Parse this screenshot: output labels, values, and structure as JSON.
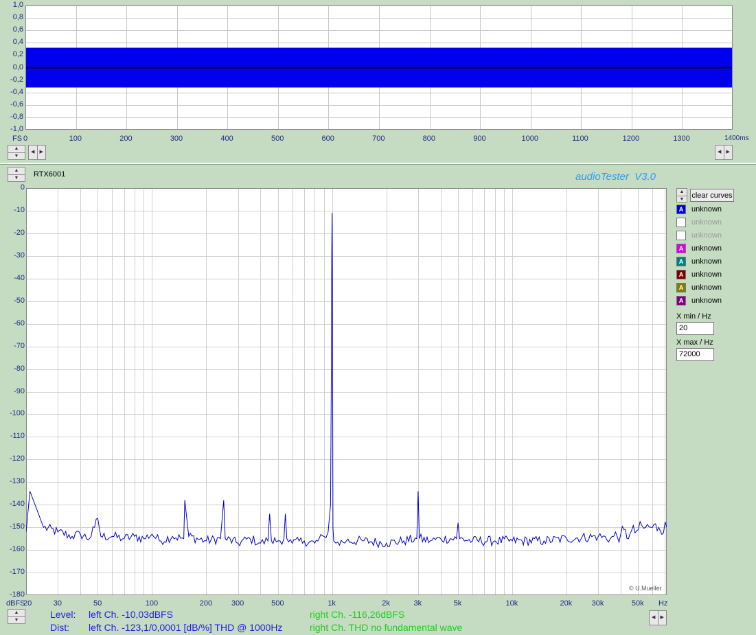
{
  "top_scope": {
    "y_ticks": [
      "1,0",
      "0,8",
      "0,6",
      "0,4",
      "0,2",
      "0,0",
      "-0,2",
      "-0,4",
      "-0,6",
      "-0,8",
      "-1,0"
    ],
    "x_ticks": [
      "0",
      "100",
      "200",
      "300",
      "400",
      "500",
      "600",
      "700",
      "800",
      "900",
      "1000",
      "1100",
      "1200",
      "1300",
      "1400ms"
    ],
    "y_unit": "FS",
    "band_level": 0.32,
    "x_max_ms": 1400
  },
  "spectrum": {
    "device": "RTX6001",
    "app_title": "audioTester  V3.0",
    "copyright": "© U.Mueller",
    "y_unit": "dBFS",
    "x_unit": "Hz",
    "y_ticks": [
      "0",
      "-10",
      "-20",
      "-30",
      "-40",
      "-50",
      "-60",
      "-70",
      "-80",
      "-90",
      "-100",
      "-110",
      "-120",
      "-130",
      "-140",
      "-150",
      "-160",
      "-170",
      "-180"
    ],
    "x_ticks": [
      "20",
      "30",
      "50",
      "100",
      "200",
      "300",
      "500",
      "1k",
      "2k",
      "3k",
      "5k",
      "10k",
      "20k",
      "30k",
      "50k"
    ]
  },
  "chart_data": {
    "type": "line",
    "title": "",
    "xlabel": "Hz",
    "ylabel": "dBFS",
    "x_scale": "log",
    "xlim": [
      20,
      72000
    ],
    "ylim": [
      -180,
      0
    ],
    "grid": true,
    "series": [
      {
        "name": "unknown",
        "color": "#0000c8",
        "x": [
          20,
          21,
          25,
          30,
          36,
          40,
          45,
          48,
          50,
          52,
          60,
          70,
          80,
          90,
          100,
          110,
          130,
          150,
          152,
          160,
          200,
          240,
          250,
          255,
          300,
          350,
          400,
          440,
          450,
          460,
          500,
          540,
          550,
          560,
          600,
          700,
          800,
          900,
          950,
          980,
          990,
          995,
          1000,
          1005,
          1010,
          1020,
          1050,
          1200,
          1500,
          2000,
          2500,
          2950,
          3000,
          3050,
          3500,
          4000,
          4900,
          5000,
          5100,
          6000,
          8000,
          10000,
          15000,
          20000,
          30000,
          35000,
          40000,
          45000,
          50000,
          55000,
          60000,
          65000,
          72000
        ],
        "y": [
          -152,
          -134,
          -150,
          -152,
          -154,
          -153,
          -155,
          -150,
          -146,
          -154,
          -154,
          -155,
          -154,
          -155,
          -153,
          -156,
          -154,
          -155,
          -138,
          -154,
          -156,
          -155,
          -138,
          -155,
          -157,
          -155,
          -157,
          -156,
          -144,
          -156,
          -156,
          -155,
          -144,
          -155,
          -157,
          -156,
          -157,
          -154,
          -152,
          -140,
          -80,
          -27,
          -11,
          -60,
          -150,
          -156,
          -157,
          -156,
          -156,
          -157,
          -156,
          -155,
          -134,
          -155,
          -156,
          -155,
          -155,
          -148,
          -155,
          -156,
          -156,
          -156,
          -156,
          -155,
          -154,
          -155,
          -153,
          -153,
          -151,
          -150,
          -150,
          -150,
          -150
        ]
      }
    ]
  },
  "legend": {
    "clear_label": "clear curves",
    "items": [
      {
        "label": "unknown",
        "color": "#0000e0",
        "active": true
      },
      {
        "label": "unknown",
        "color": "#ffffff",
        "active": false
      },
      {
        "label": "unknown",
        "color": "#ffffff",
        "active": false
      },
      {
        "label": "unknown",
        "color": "#e000e0",
        "active": true
      },
      {
        "label": "unknown",
        "color": "#008080",
        "active": true
      },
      {
        "label": "unknown",
        "color": "#800000",
        "active": true
      },
      {
        "label": "unknown",
        "color": "#808000",
        "active": true
      },
      {
        "label": "unknown",
        "color": "#800080",
        "active": true
      }
    ],
    "marker_glyph": "A"
  },
  "controls": {
    "xmin_label": "X min / Hz",
    "xmin_value": "20",
    "xmax_label": "X max / Hz",
    "xmax_value": "72000"
  },
  "status": {
    "level_label": "Level:",
    "dist_label": "Dist:",
    "level_left": "left Ch. -10,03dBFS",
    "level_right": "right Ch. -116,26dBFS",
    "dist_left": "left Ch. -123,1/0,0001 [dB/%] THD @ 1000Hz",
    "dist_right": "right Ch. THD no fundamental wave",
    "left_color": "#2020e0",
    "right_color": "#22cc22"
  }
}
